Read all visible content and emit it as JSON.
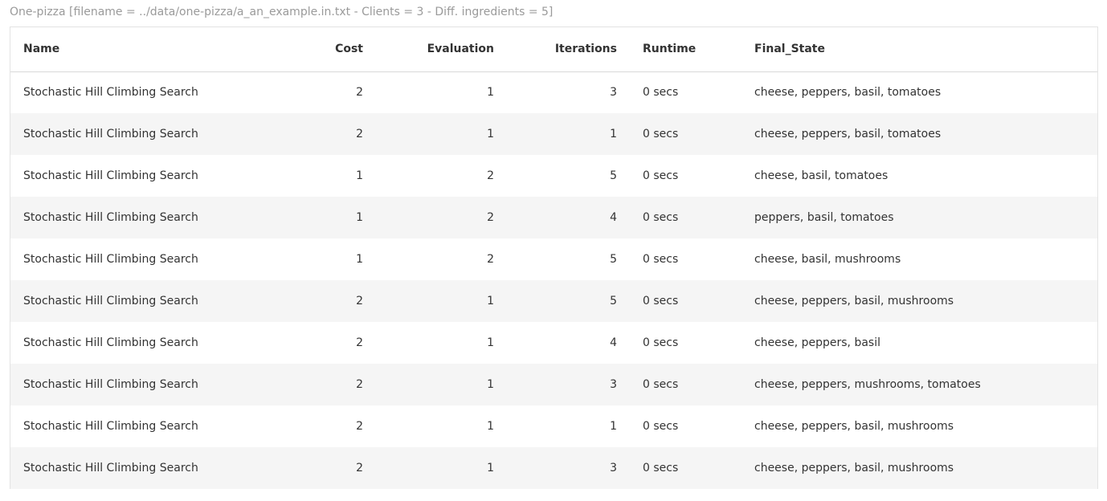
{
  "caption": "One-pizza [filename = ../data/one-pizza/a_an_example.in.txt - Clients = 3 - Diff. ingredients = 5]",
  "columns": {
    "name": "Name",
    "cost": "Cost",
    "evaluation": "Evaluation",
    "iterations": "Iterations",
    "runtime": "Runtime",
    "final_state": "Final_State"
  },
  "rows": [
    {
      "name": "Stochastic Hill Climbing Search",
      "cost": "2",
      "evaluation": "1",
      "iterations": "3",
      "runtime": "0 secs",
      "final_state": "cheese, peppers, basil, tomatoes"
    },
    {
      "name": "Stochastic Hill Climbing Search",
      "cost": "2",
      "evaluation": "1",
      "iterations": "1",
      "runtime": "0 secs",
      "final_state": "cheese, peppers, basil, tomatoes"
    },
    {
      "name": "Stochastic Hill Climbing Search",
      "cost": "1",
      "evaluation": "2",
      "iterations": "5",
      "runtime": "0 secs",
      "final_state": "cheese, basil, tomatoes"
    },
    {
      "name": "Stochastic Hill Climbing Search",
      "cost": "1",
      "evaluation": "2",
      "iterations": "4",
      "runtime": "0 secs",
      "final_state": "peppers, basil, tomatoes"
    },
    {
      "name": "Stochastic Hill Climbing Search",
      "cost": "1",
      "evaluation": "2",
      "iterations": "5",
      "runtime": "0 secs",
      "final_state": "cheese, basil, mushrooms"
    },
    {
      "name": "Stochastic Hill Climbing Search",
      "cost": "2",
      "evaluation": "1",
      "iterations": "5",
      "runtime": "0 secs",
      "final_state": "cheese, peppers, basil, mushrooms"
    },
    {
      "name": "Stochastic Hill Climbing Search",
      "cost": "2",
      "evaluation": "1",
      "iterations": "4",
      "runtime": "0 secs",
      "final_state": "cheese, peppers, basil"
    },
    {
      "name": "Stochastic Hill Climbing Search",
      "cost": "2",
      "evaluation": "1",
      "iterations": "3",
      "runtime": "0 secs",
      "final_state": "cheese, peppers, mushrooms, tomatoes"
    },
    {
      "name": "Stochastic Hill Climbing Search",
      "cost": "2",
      "evaluation": "1",
      "iterations": "1",
      "runtime": "0 secs",
      "final_state": "cheese, peppers, basil, mushrooms"
    },
    {
      "name": "Stochastic Hill Climbing Search",
      "cost": "2",
      "evaluation": "1",
      "iterations": "3",
      "runtime": "0 secs",
      "final_state": "cheese, peppers, basil, mushrooms"
    }
  ]
}
